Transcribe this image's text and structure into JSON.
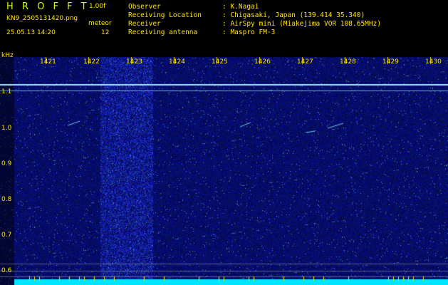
{
  "header": {
    "app_title": "H R O F F T",
    "version": "1.00f",
    "file_name": "KN9_2505131420.png",
    "meteor_label": "meteor",
    "meteor_count": "12",
    "datetime": "25.05.13 14:20",
    "info": [
      {
        "key": "Observer",
        "value": ": K.Nagai"
      },
      {
        "key": "Receiving Location",
        "value": ": Chigasaki, Japan (139.414 35.340)"
      },
      {
        "key": "Receiver",
        "value": ": AirSpy mini (Miakejima VOR 108.65MHz)"
      },
      {
        "key": "Receiving antenna",
        "value": ": Maspro FM-3"
      }
    ]
  },
  "spectrogram": {
    "y_unit": "kHz",
    "y_ticks": [
      "1.1",
      "1.0",
      "0.9",
      "0.8",
      "0.7",
      "0.6"
    ],
    "x_ticks": [
      "1421",
      "1422",
      "1423",
      "1424",
      "1425",
      "1426",
      "1427",
      "1428",
      "1429",
      "1430"
    ],
    "colors": {
      "background": "#000000",
      "noise_base": "#0a1a8c",
      "label": "#ffe600",
      "carrier": "#9fe8ff",
      "baseline": "#00e5ff"
    }
  }
}
